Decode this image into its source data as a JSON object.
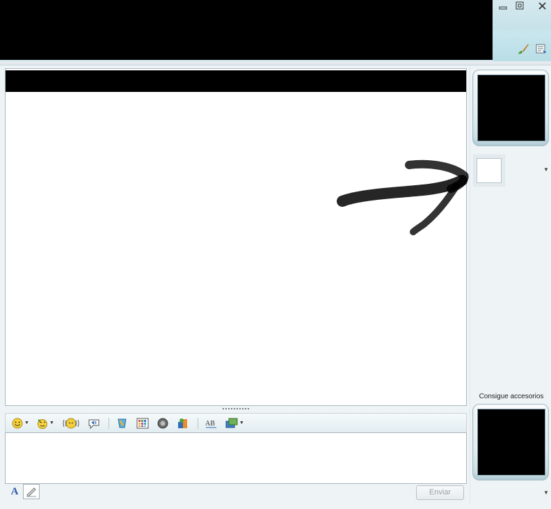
{
  "window": {
    "controls": {
      "minimize": "minimize",
      "maximize": "maximize",
      "close": "close"
    },
    "toolbar_icons": [
      "paintbrush-icon",
      "menu-icon"
    ]
  },
  "conversation": {
    "history_text": "",
    "resize_grip": "••••••••••"
  },
  "toolbar": {
    "items": [
      {
        "name": "emoticon-icon",
        "has_dropdown": true
      },
      {
        "name": "wink-icon",
        "has_dropdown": true
      },
      {
        "name": "nudge-icon",
        "has_dropdown": false
      },
      {
        "name": "voice-clip-icon",
        "has_dropdown": false
      },
      {
        "name": "games-icon",
        "has_dropdown": false
      },
      {
        "name": "backgrounds-icon",
        "has_dropdown": false
      },
      {
        "name": "audio-icon",
        "has_dropdown": false
      },
      {
        "name": "activities-icon",
        "has_dropdown": false
      },
      {
        "name": "spellcheck-icon",
        "has_dropdown": false
      },
      {
        "name": "share-icon",
        "has_dropdown": true
      }
    ]
  },
  "compose": {
    "font_label": "A",
    "send_label": "Enviar",
    "text": ""
  },
  "sidebar": {
    "accessories_label": "Consigue accesorios"
  },
  "colors": {
    "title_gradient": "#c7e2ea",
    "send_disabled_text": "#9aa3a7",
    "font_button_text": "#2b58a6"
  }
}
